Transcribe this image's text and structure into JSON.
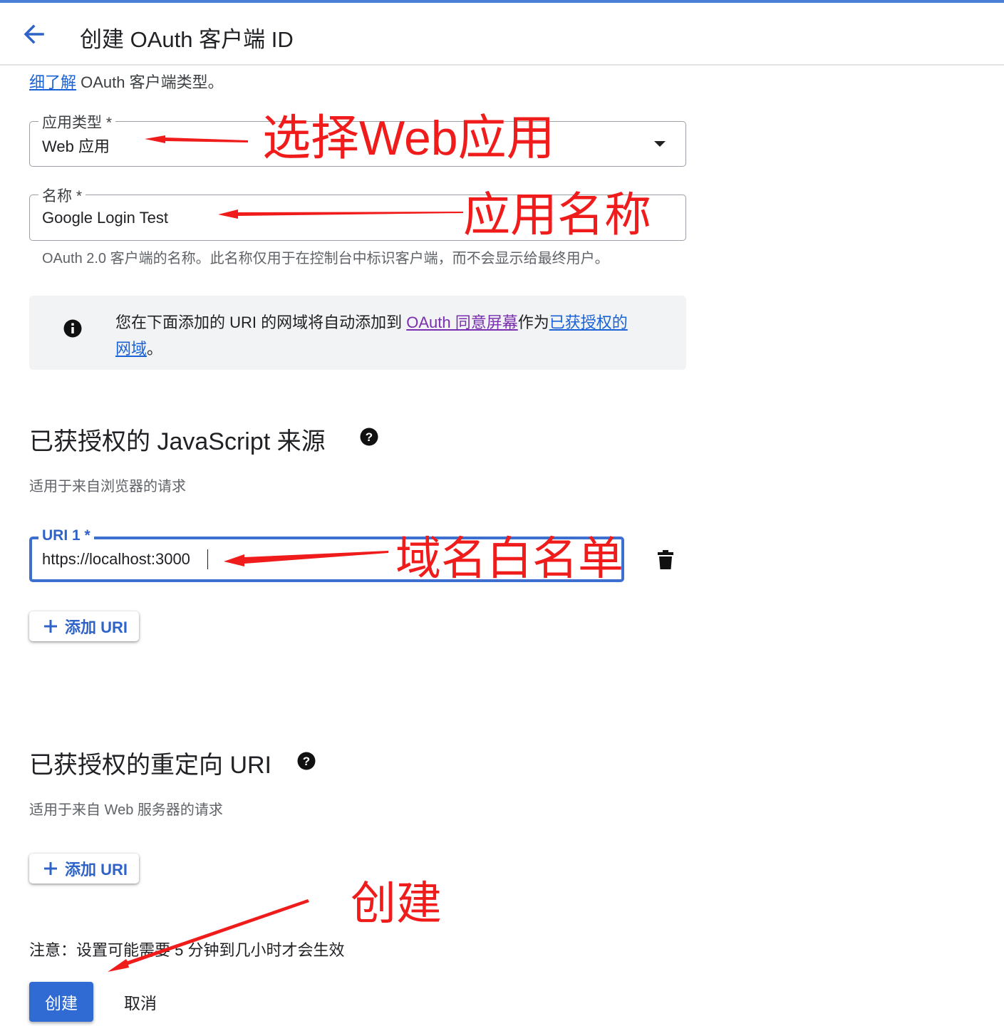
{
  "header": {
    "title": "创建 OAuth 客户端 ID"
  },
  "intro": {
    "link": "细了解",
    "text": " OAuth 客户端类型。"
  },
  "app_type": {
    "label": "应用类型 *",
    "value": "Web 应用"
  },
  "name_field": {
    "label": "名称 *",
    "value": "Google Login Test",
    "hint": "OAuth 2.0 客户端的名称。此名称仅用于在控制台中标识客户端，而不会显示给最终用户。"
  },
  "notice": {
    "prefix": "您在下面添加的 URI 的网域将自动添加到 ",
    "consent_link": "OAuth 同意屏幕",
    "middle": "作为",
    "domains_link_a": "已获授权的",
    "domains_link_b": "网域",
    "suffix": "。"
  },
  "js_origins": {
    "title": "已获授权的 JavaScript 来源",
    "subtitle": "适用于来自浏览器的请求",
    "uri_label": "URI 1 *",
    "uri_value": "https://localhost:3000",
    "add_label": "添加 URI"
  },
  "redirect_uris": {
    "title": "已获授权的重定向 URI",
    "subtitle": "适用于来自 Web 服务器的请求",
    "add_label": "添加 URI"
  },
  "footer": {
    "note": "注意：设置可能需要 5 分钟到几小时才会生效",
    "create_label": "创建",
    "cancel_label": "取消"
  },
  "annotations": {
    "select_web": "选择Web应用",
    "app_name": "应用名称",
    "domain_whitelist": "域名白名单",
    "create": "创建",
    "color": "#f01c1c"
  },
  "colors": {
    "accent": "#2f6bd3",
    "link": "#1a62d6",
    "visited_link": "#7a2fb0"
  },
  "icons": [
    "back-arrow-icon",
    "dropdown-arrow-icon",
    "info-icon",
    "help-icon",
    "delete-icon",
    "plus-icon"
  ]
}
